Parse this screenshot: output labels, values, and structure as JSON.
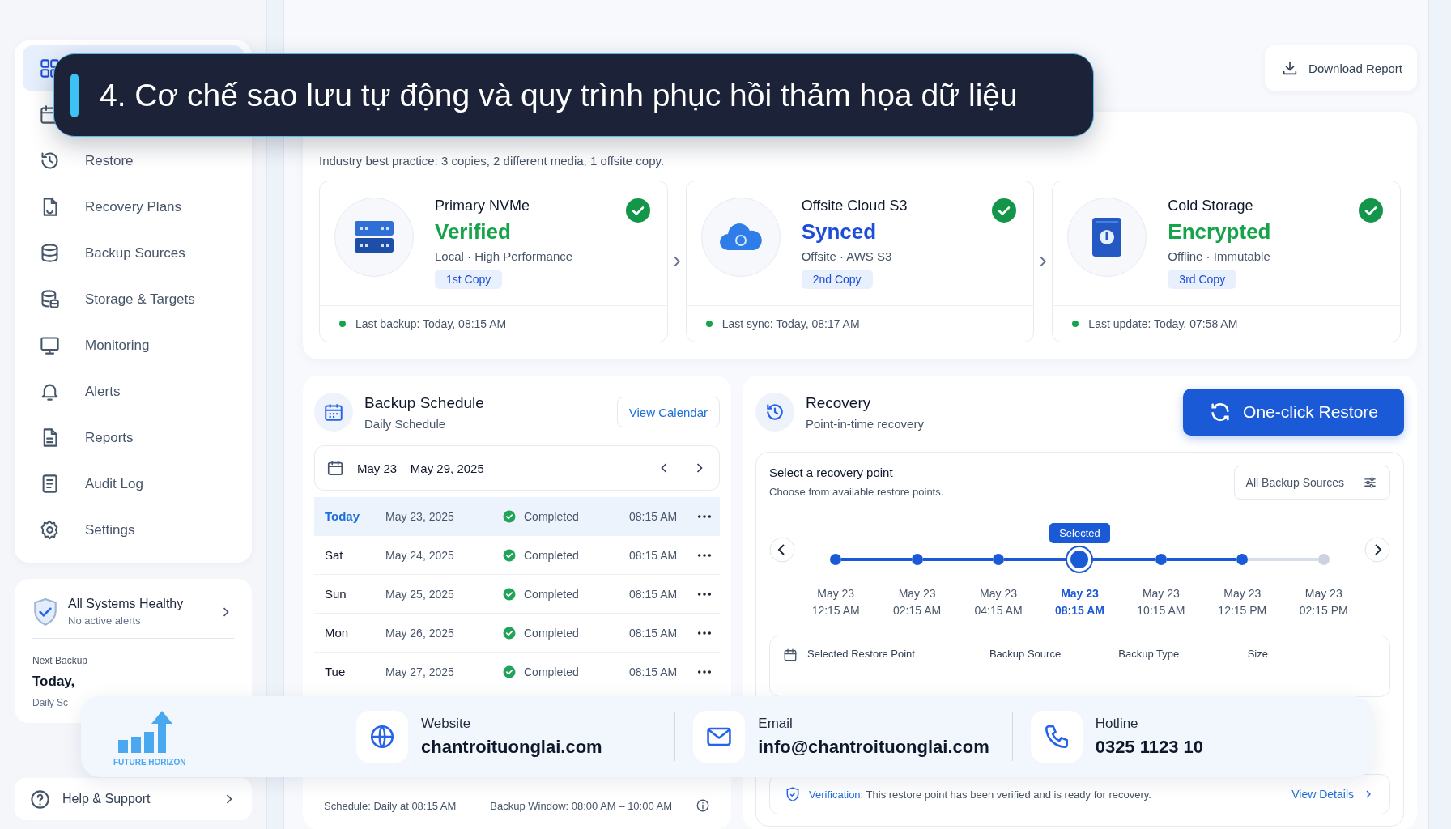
{
  "banner": {
    "title": "4. Cơ chế sao lưu tự động và quy trình phục hồi thảm họa dữ liệu"
  },
  "sidebar": {
    "items": [
      {
        "selected": true
      },
      {
        "selected": false
      },
      {
        "label": "Restore",
        "selected": false
      },
      {
        "label": "Recovery Plans",
        "selected": false
      },
      {
        "label": "Backup Sources",
        "selected": false
      },
      {
        "label": "Storage & Targets",
        "selected": false
      },
      {
        "label": "Monitoring",
        "selected": false
      },
      {
        "label": "Alerts",
        "selected": false
      },
      {
        "label": "Reports",
        "selected": false
      },
      {
        "label": "Audit Log",
        "selected": false
      },
      {
        "label": "Settings",
        "selected": false
      }
    ],
    "health": {
      "title": "All Systems Healthy",
      "subtitle": "No active alerts",
      "next_label": "Next Backup",
      "next_value": "Today,",
      "next_note": "Daily Sc"
    },
    "help": "Help & Support"
  },
  "header": {
    "download_button": "Download Report"
  },
  "storage": {
    "subtitle": "Industry best practice: 3 copies, 2 different media, 1 offsite copy.",
    "cards": [
      {
        "kind": "server",
        "name": "Primary NVMe",
        "status": "Verified",
        "color": "#16a34a",
        "detail": "Local · High Performance",
        "badge": "1st Copy",
        "footer": "Last backup: Today, 08:15 AM"
      },
      {
        "kind": "cloud",
        "name": "Offsite Cloud S3",
        "status": "Synced",
        "color": "#1d4ed8",
        "detail": "Offsite · AWS S3",
        "badge": "2nd Copy",
        "footer": "Last sync: Today, 08:17 AM"
      },
      {
        "kind": "vault",
        "name": "Cold Storage",
        "status": "Encrypted",
        "color": "#16a34a",
        "detail": "Offline · Immutable",
        "badge": "3rd Copy",
        "footer": "Last update: Today, 07:58 AM"
      }
    ]
  },
  "schedule": {
    "title": "Backup Schedule",
    "subtitle": "Daily Schedule",
    "calendar_button": "View Calendar",
    "range": "May 23 – May 29, 2025",
    "rows": [
      {
        "day": "Today",
        "date": "May 23, 2025",
        "status": "Completed",
        "time": "08:15 AM",
        "selected": true
      },
      {
        "day": "Sat",
        "date": "May 24, 2025",
        "status": "Completed",
        "time": "08:15 AM",
        "selected": false
      },
      {
        "day": "Sun",
        "date": "May 25, 2025",
        "status": "Completed",
        "time": "08:15 AM",
        "selected": false
      },
      {
        "day": "Mon",
        "date": "May 26, 2025",
        "status": "Completed",
        "time": "08:15 AM",
        "selected": false
      },
      {
        "day": "Tue",
        "date": "May 27, 2025",
        "status": "Completed",
        "time": "08:15 AM",
        "selected": false
      }
    ],
    "footer_schedule": "Schedule: Daily at 08:15 AM",
    "footer_window": "Backup Window: 08:00 AM – 10:00 AM"
  },
  "recovery": {
    "title": "Recovery",
    "subtitle": "Point-in-time recovery",
    "restore_button": "One-click Restore",
    "select_title": "Select a recovery point",
    "select_subtitle": "Choose from available restore points.",
    "filter": "All Backup Sources",
    "selected_tag": "Selected",
    "points": [
      {
        "date": "May 23",
        "time": "12:15 AM",
        "selected": false,
        "available": true
      },
      {
        "date": "May 23",
        "time": "02:15 AM",
        "selected": false,
        "available": true
      },
      {
        "date": "May 23",
        "time": "04:15 AM",
        "selected": false,
        "available": true
      },
      {
        "date": "May 23",
        "time": "08:15 AM",
        "selected": true,
        "available": true
      },
      {
        "date": "May 23",
        "time": "10:15 AM",
        "selected": false,
        "available": true
      },
      {
        "date": "May 23",
        "time": "12:15 PM",
        "selected": false,
        "available": true
      },
      {
        "date": "May 23",
        "time": "02:15 PM",
        "selected": false,
        "available": false
      }
    ],
    "details_columns": [
      "Selected Restore Point",
      "Backup Source",
      "Backup Type",
      "Size"
    ],
    "verification": "**Verification:** This restore point has been verified and is ready for recovery.",
    "view_details": "View Details"
  },
  "contact_bar": {
    "brand": "FUTURE HORIZON",
    "items": [
      {
        "kind": "website",
        "label": "Website",
        "value": "chantroituonglai.com"
      },
      {
        "kind": "email",
        "label": "Email",
        "value": "info@chantroituonglai.com"
      },
      {
        "kind": "phone",
        "label": "Hotline",
        "value": "0325 1123 10"
      }
    ]
  }
}
